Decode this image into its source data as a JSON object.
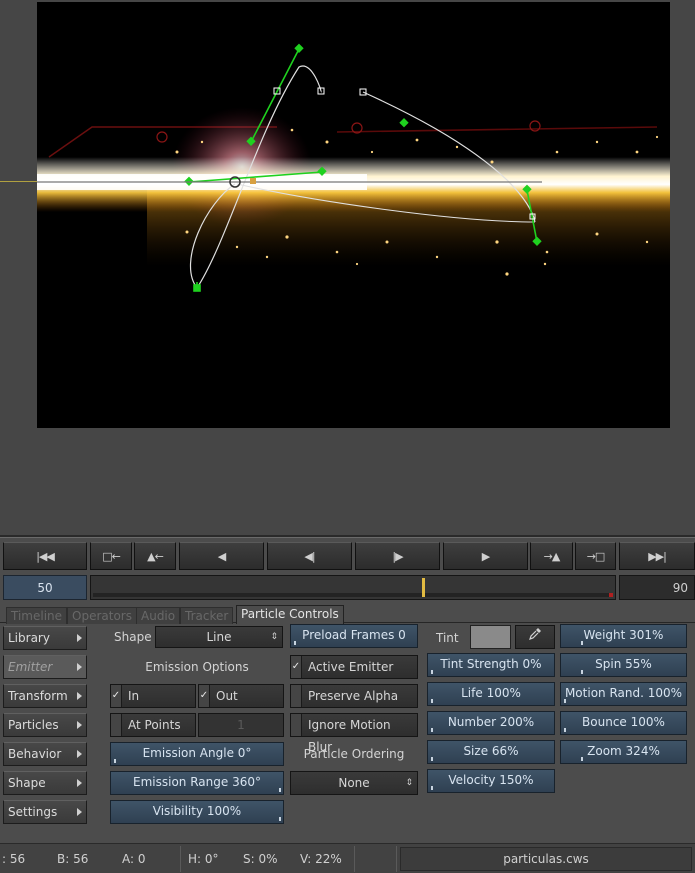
{
  "transport": {
    "go_start": "|◀◀",
    "mark_in": "□←",
    "prev_key": "▲←",
    "play_back": "◀",
    "step_back": "◀|",
    "step_fwd": "|▶",
    "play": "▶",
    "next_key": "→▲",
    "mark_out": "→□",
    "go_end": "▶▶|"
  },
  "timeline": {
    "in_frame": "50",
    "out_frame": "90",
    "playhead_frame": 57,
    "range": [
      0,
      90
    ]
  },
  "tabs": [
    "Timeline",
    "Operators",
    "Audio",
    "Tracker",
    "Particle Controls"
  ],
  "sidebar": [
    "Library",
    "Emitter",
    "Transform",
    "Particles",
    "Behavior",
    "Shape",
    "Settings"
  ],
  "emitter": {
    "shape_label": "Shape",
    "shape_value": "Line",
    "emission_options": "Emission Options",
    "in_label": "In",
    "out_label": "Out",
    "at_points_label": "At Points",
    "at_points_value": "1",
    "emission_angle": "Emission Angle 0°",
    "emission_range": "Emission Range 360°",
    "visibility": "Visibility 100%"
  },
  "middle": {
    "preload_frames": "Preload Frames 0",
    "active_emitter": "Active Emitter",
    "preserve_alpha": "Preserve Alpha",
    "ignore_motion_blur": "Ignore Motion Blur",
    "particle_ordering": "Particle Ordering",
    "ordering_value": "None"
  },
  "particles": {
    "tint_label": "Tint",
    "tint_color": "#8a8a8a",
    "weight": "Weight 301%",
    "tint_strength": "Tint Strength 0%",
    "spin": "Spin 55%",
    "life": "Life 100%",
    "motion_rand": "Motion Rand. 100%",
    "number": "Number 200%",
    "bounce": "Bounce 100%",
    "size": "Size 66%",
    "zoom": "Zoom 324%",
    "velocity": "Velocity 150%"
  },
  "status": {
    "r": ": 56",
    "b": "B: 56",
    "a": "A: 0",
    "h": "H: 0°",
    "s": "S: 0%",
    "v": "V: 22%",
    "filename": "particulas.cws"
  }
}
